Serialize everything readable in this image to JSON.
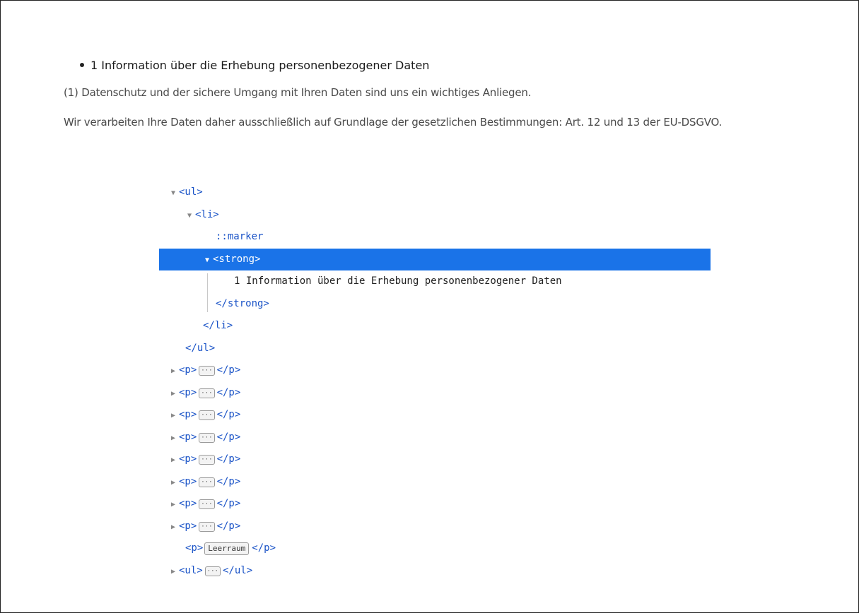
{
  "page": {
    "heading": "1 Information über die Erhebung personenbezogener Daten",
    "para1": "(1) Datenschutz und der sichere Umgang mit Ihren Daten sind uns ein wichtiges Anliegen.",
    "para2": "Wir verarbeiten Ihre Daten daher ausschließlich auf Grundlage der gesetzlichen Bestimmungen: Art. 12 und 13 der EU-DSGVO."
  },
  "inspector": {
    "ul_open": "<ul>",
    "li_open": "<li>",
    "marker": "::marker",
    "strong_open": "<strong>",
    "strong_text": "1 Information über die Erhebung personenbezogener Daten",
    "strong_close": "</strong>",
    "li_close": "</li>",
    "ul_close": "</ul>",
    "p_open": "<p>",
    "p_close": "</p>",
    "ellipsis": "···",
    "whitespace_label": "Leerraum",
    "p_collapsed_count": 8,
    "ul2_open": "<ul>",
    "ul2_close": "</ul>"
  },
  "icons": {
    "expanded": "triangle-down-icon",
    "collapsed": "triangle-right-icon"
  },
  "colors": {
    "selection": "#1a73e8",
    "tag": "#1a53c7"
  }
}
